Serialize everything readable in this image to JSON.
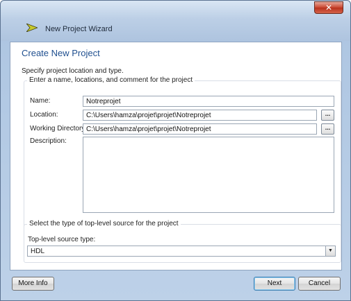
{
  "window": {
    "title": "New Project Wizard",
    "close_glyph": "✕"
  },
  "page": {
    "heading": "Create New Project",
    "subheading": "Specify project location and type."
  },
  "details_group": {
    "title": "Enter a name, locations, and comment for the project",
    "name_label": "Name:",
    "name_value": "Notreprojet",
    "location_label": "Location:",
    "location_value": "C:\\Users\\hamza\\projet\\projet\\Notreprojet",
    "working_dir_label": "Working Directory:",
    "working_dir_value": "C:\\Users\\hamza\\projet\\projet\\Notreprojet",
    "description_label": "Description:",
    "description_value": "",
    "browse_label": "..."
  },
  "source_group": {
    "title": "Select the type of top-level source for the project",
    "type_label": "Top-level source type:",
    "type_value": "HDL"
  },
  "buttons": {
    "more_info": "More Info",
    "next": "Next",
    "cancel": "Cancel"
  }
}
